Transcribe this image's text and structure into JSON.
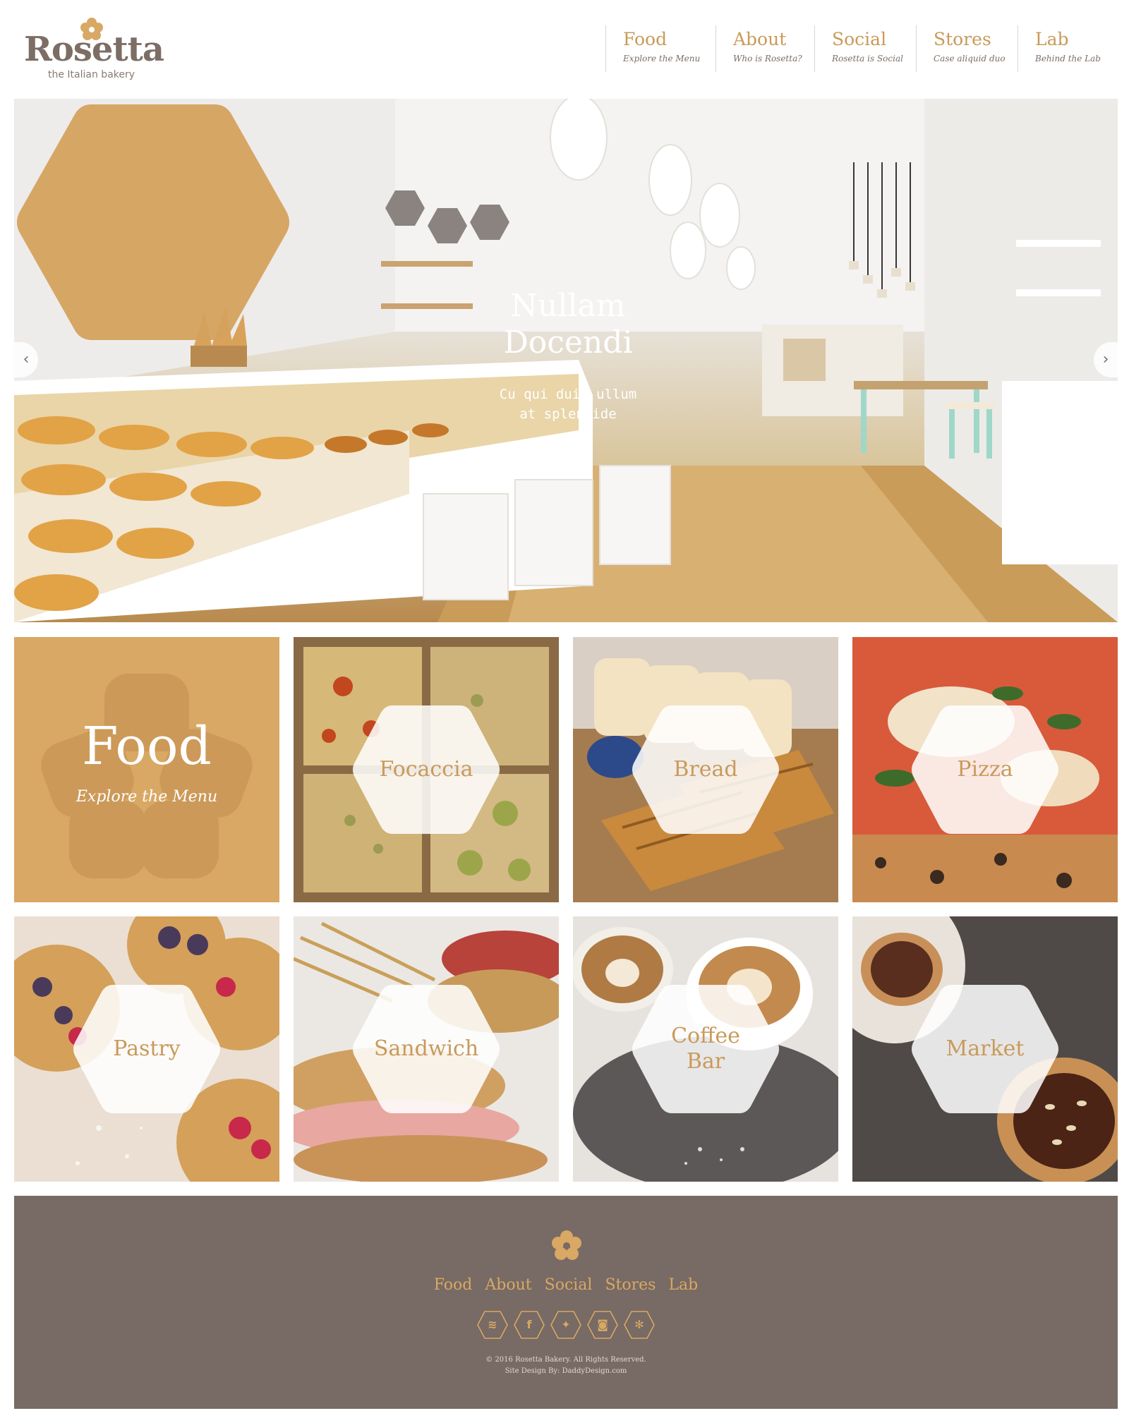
{
  "brand": {
    "name": "Rosetta",
    "tagline": "the Italian bakery"
  },
  "colors": {
    "accent": "#d8a864",
    "accent_text": "#c99a5b",
    "text": "#7c6d65",
    "footer_bg": "#786a64"
  },
  "nav": [
    {
      "title": "Food",
      "sub": "Explore the Menu"
    },
    {
      "title": "About",
      "sub": "Who is Rosetta?"
    },
    {
      "title": "Social",
      "sub": "Rosetta is Social"
    },
    {
      "title": "Stores",
      "sub": "Case aliquid duo"
    },
    {
      "title": "Lab",
      "sub": "Behind the Lab"
    }
  ],
  "hero": {
    "title_line1": "Nullam",
    "title_line2": "Docendi",
    "sub_line1": "Cu qui duis ullum",
    "sub_line2": "at splendide",
    "prev_icon": "‹",
    "next_icon": "›"
  },
  "feature": {
    "title": "Food",
    "sub": "Explore the Menu"
  },
  "tiles": [
    {
      "label": "Focaccia",
      "image": "focaccia-photo"
    },
    {
      "label": "Bread",
      "image": "bread-photo"
    },
    {
      "label": "Pizza",
      "image": "pizza-photo"
    },
    {
      "label": "Pastry",
      "image": "pastry-photo"
    },
    {
      "label": "Sandwich",
      "image": "sandwich-photo"
    },
    {
      "label_line1": "Coffee",
      "label_line2": "Bar",
      "image": "coffee-photo"
    },
    {
      "label": "Market",
      "image": "market-photo"
    }
  ],
  "footer": {
    "links": [
      "Food",
      "About",
      "Social",
      "Stores",
      "Lab"
    ],
    "social": [
      {
        "name": "rss-icon",
        "glyph": "≋"
      },
      {
        "name": "facebook-icon",
        "glyph": "f"
      },
      {
        "name": "twitter-icon",
        "glyph": "✦"
      },
      {
        "name": "instagram-icon",
        "glyph": "◙"
      },
      {
        "name": "yelp-icon",
        "glyph": "✻"
      }
    ],
    "copyright": "© 2016 Rosetta Bakery. All Rights Reserved.",
    "credit": "Site Design By: DaddyDesign.com"
  }
}
